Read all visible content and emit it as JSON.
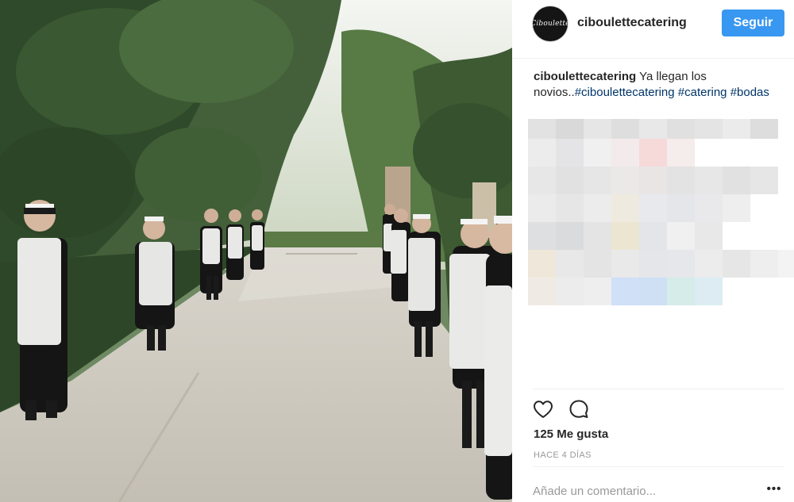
{
  "post": {
    "image_alt": "Fila de camareras con delantal blanco en un camino entre árboles",
    "username": "ciboulettecatering",
    "avatar_text": "Ciboulette",
    "follow_label": "Seguir",
    "caption": {
      "user": "ciboulettecatering",
      "text": "Ya llegan los novios..",
      "hashtags": [
        "#ciboulettecatering",
        "#catering",
        "#bodas"
      ]
    },
    "likes_label": "125 Me gusta",
    "time_label": "HACE 4 DÍAS",
    "comment_placeholder": "Añade un comentario...",
    "more_label": "•••"
  },
  "icons": {
    "like": "heart-icon",
    "comment": "comment-bubble-icon",
    "more": "more-options-icon"
  },
  "colors": {
    "follow_button": "#3897f0",
    "hashtag": "#003569",
    "text": "#262626",
    "muted": "#999999"
  }
}
